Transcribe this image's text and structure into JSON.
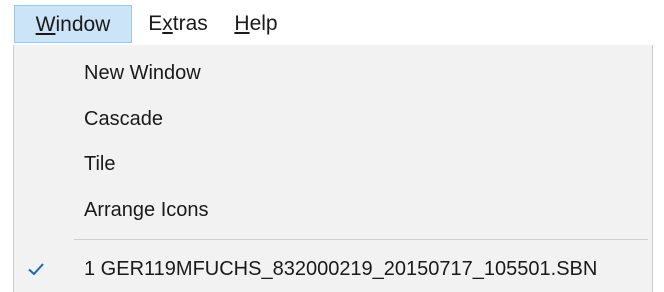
{
  "menubar": {
    "items": [
      {
        "mnemonic": "W",
        "rest": "indow"
      },
      {
        "pre": "E",
        "mnemonic": "x",
        "rest": "tras"
      },
      {
        "mnemonic": "H",
        "rest": "elp"
      }
    ]
  },
  "window_menu": {
    "items": [
      {
        "label": "New Window"
      },
      {
        "label": "Cascade"
      },
      {
        "label": "Tile"
      },
      {
        "label": "Arrange Icons"
      }
    ],
    "open_files": [
      {
        "label": "1 GER119MFUCHS_832000219_20150717_105501.SBN",
        "checked": true,
        "icon": "checkmark-icon"
      }
    ]
  },
  "colors": {
    "highlight": "#cce4f7",
    "menu_background": "#f2f2f2",
    "check": "#1a66b3"
  }
}
